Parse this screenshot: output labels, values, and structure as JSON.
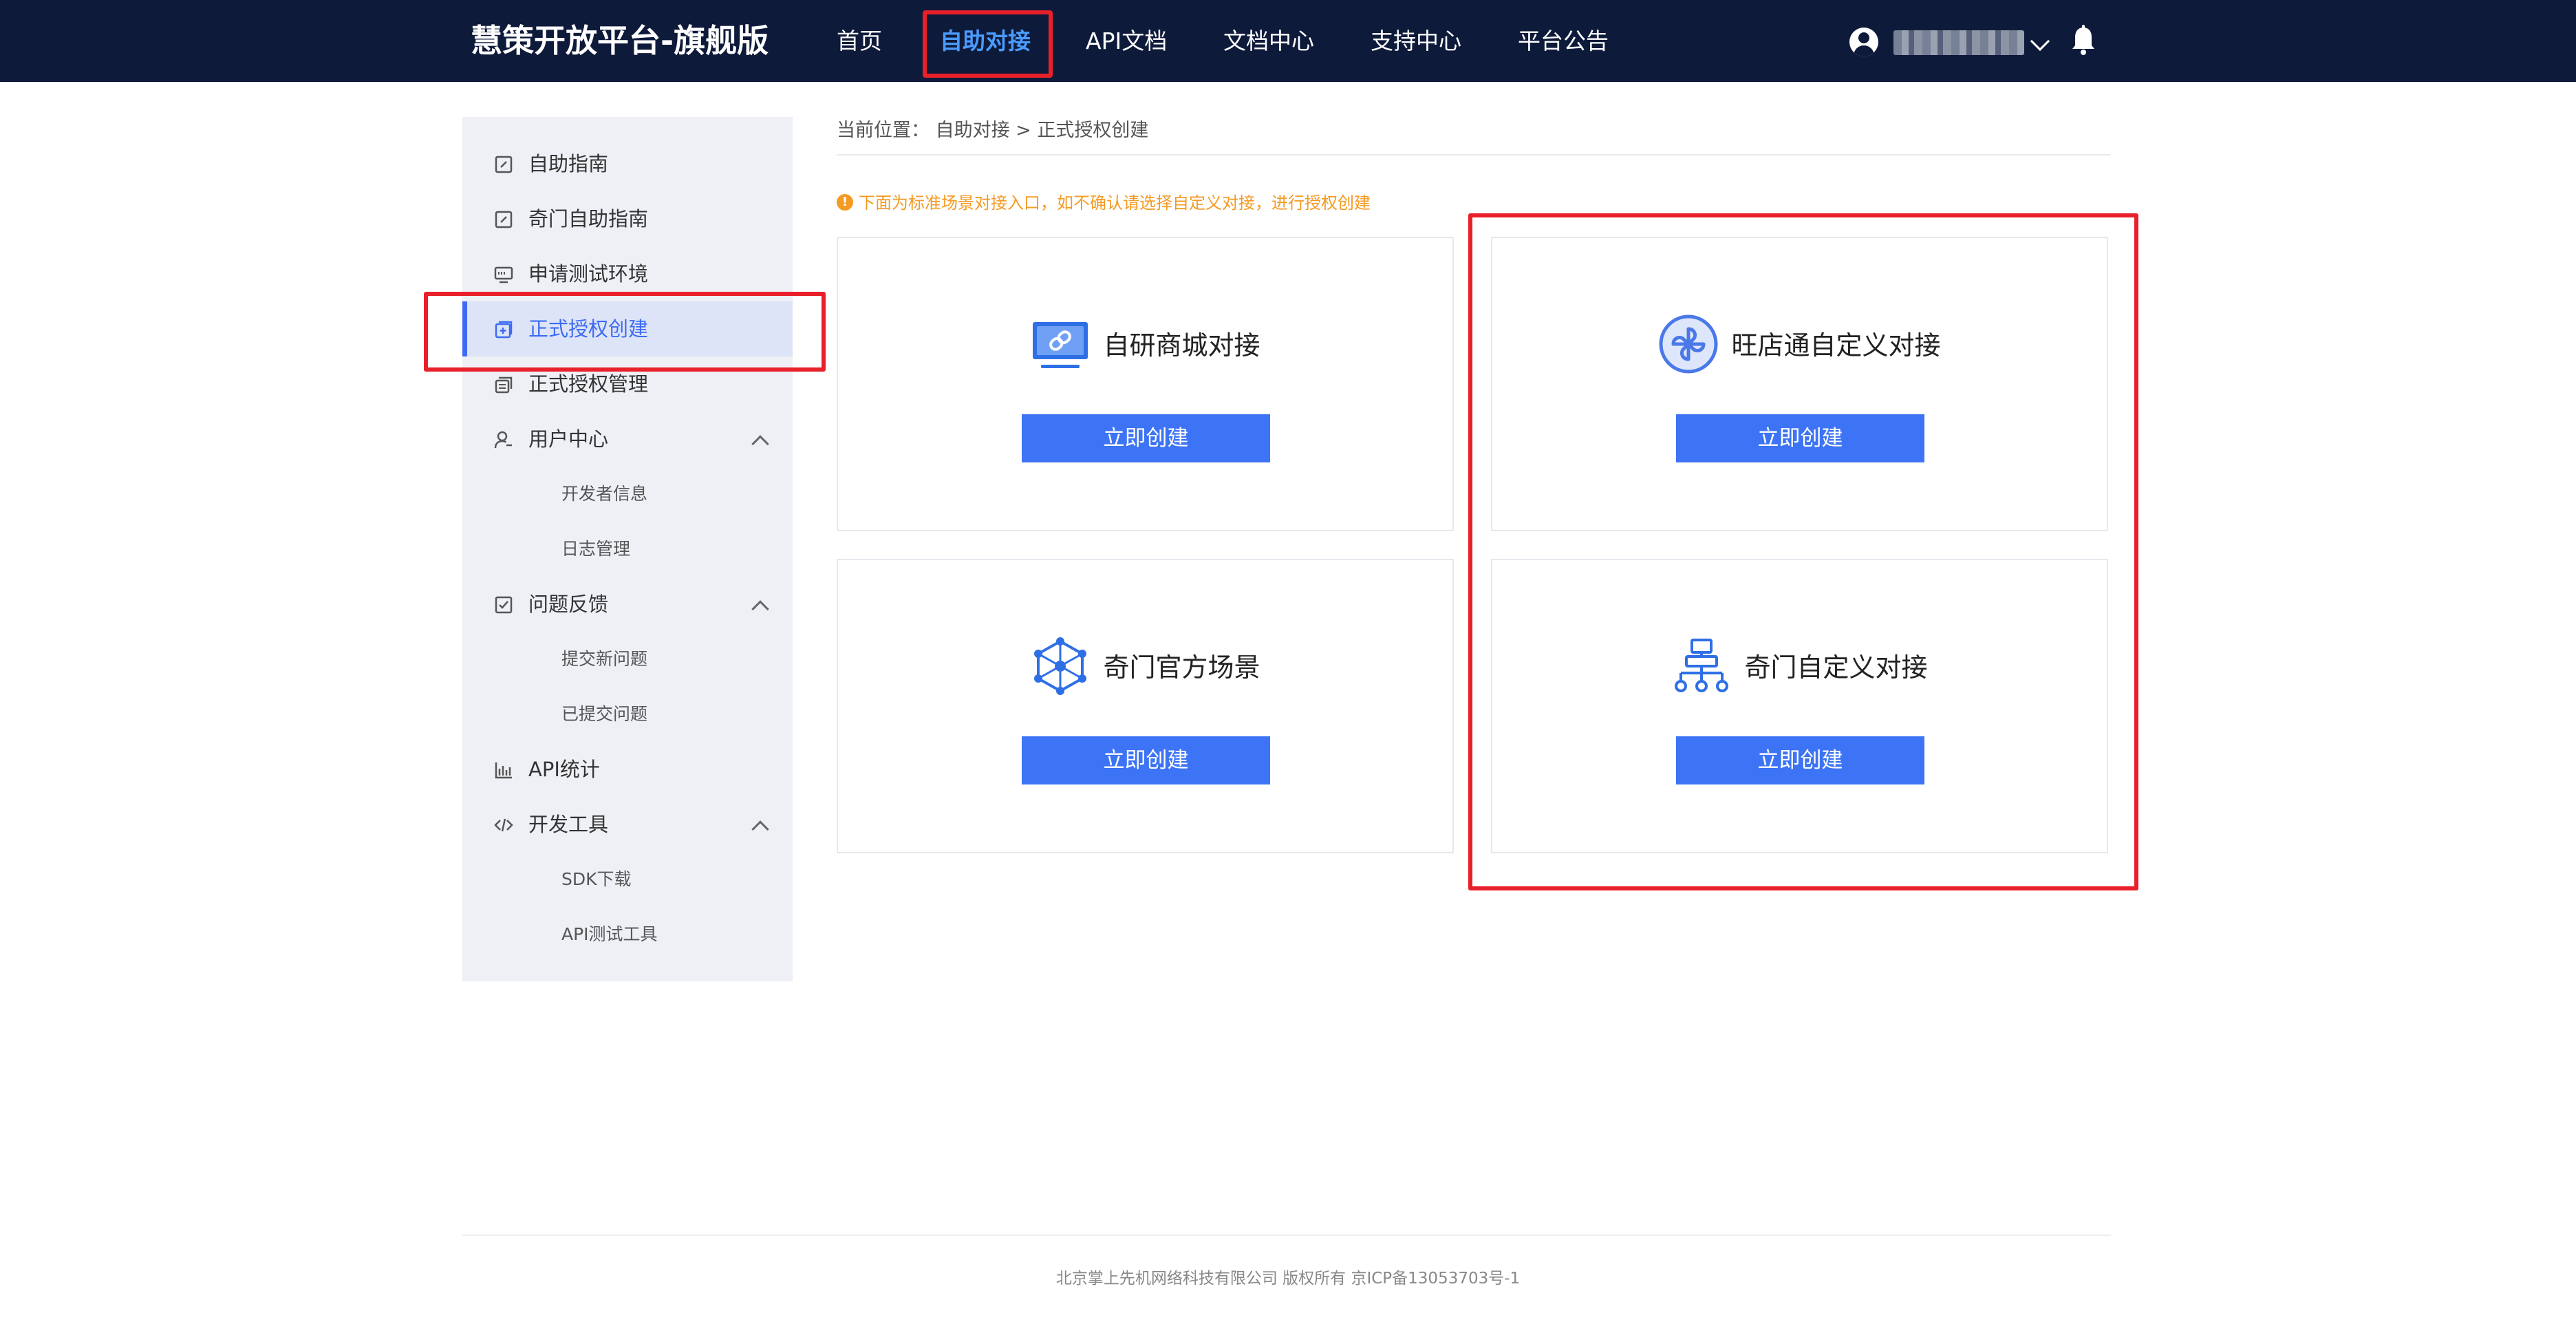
{
  "header": {
    "brand": "慧策开放平台-旗舰版",
    "nav": [
      {
        "label": "首页",
        "active": false
      },
      {
        "label": "自助对接",
        "active": true
      },
      {
        "label": "API文档",
        "active": false
      },
      {
        "label": "文档中心",
        "active": false
      },
      {
        "label": "支持中心",
        "active": false
      },
      {
        "label": "平台公告",
        "active": false
      }
    ],
    "user_icon": "user-avatar-icon",
    "bell_icon": "bell-icon"
  },
  "sidebar": {
    "items": [
      {
        "label": "自助指南",
        "icon": "edit-icon"
      },
      {
        "label": "奇门自助指南",
        "icon": "edit-icon"
      },
      {
        "label": "申请测试环境",
        "icon": "monitor-icon"
      },
      {
        "label": "正式授权创建",
        "icon": "plus-box-icon",
        "active": true
      },
      {
        "label": "正式授权管理",
        "icon": "stack-icon"
      },
      {
        "label": "用户中心",
        "icon": "user-icon",
        "expanded": true,
        "children": [
          "开发者信息",
          "日志管理"
        ]
      },
      {
        "label": "问题反馈",
        "icon": "checklist-icon",
        "expanded": true,
        "children": [
          "提交新问题",
          "已提交问题"
        ]
      },
      {
        "label": "API统计",
        "icon": "bar-chart-icon"
      },
      {
        "label": "开发工具",
        "icon": "code-icon",
        "expanded": true,
        "children": [
          "SDK下载",
          "API测试工具"
        ]
      }
    ]
  },
  "main": {
    "breadcrumb": "当前位置： 自助对接 > 正式授权创建",
    "notice": "下面为标准场景对接入口，如不确认请选择自定义对接，进行授权创建",
    "cards": [
      {
        "title": "自研商城对接",
        "icon": "monitor-link-icon",
        "button": "立即创建"
      },
      {
        "title": "旺店通自定义对接",
        "icon": "pinwheel-icon",
        "button": "立即创建"
      },
      {
        "title": "奇门官方场景",
        "icon": "network-hexagon-icon",
        "button": "立即创建"
      },
      {
        "title": "奇门自定义对接",
        "icon": "org-tree-icon",
        "button": "立即创建"
      }
    ]
  },
  "footer": {
    "text": "北京掌上先机网络科技有限公司 版权所有 京ICP备13053703号-1"
  },
  "colors": {
    "topbar": "#0e1a3a",
    "accent": "#3d74f5",
    "nav_active": "#4a9bff",
    "notice": "#f59a23",
    "highlight_box": "#e8202a",
    "sidebar_bg": "#eef0f6"
  }
}
